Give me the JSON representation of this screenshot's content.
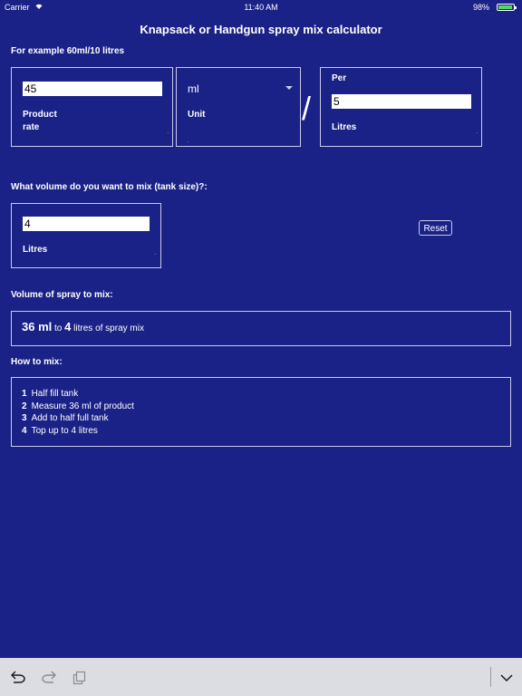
{
  "status_bar": {
    "carrier": "Carrier",
    "time": "11:40 AM",
    "battery": "98%",
    "battery_color": "#4cd964"
  },
  "header": {
    "title": "Knapsack or Handgun spray mix calculator"
  },
  "rate_section": {
    "example": "For example 60ml/10 litres",
    "product_rate": {
      "value": "45",
      "label_line1": "Product",
      "label_line2": "rate"
    },
    "unit": {
      "value": "ml",
      "label": "Unit"
    },
    "separator": "/",
    "per": {
      "heading": "Per",
      "value": "5",
      "label": "Litres"
    }
  },
  "tank_section": {
    "question": "What volume do you want to mix (tank size)?:",
    "tank": {
      "value": "4",
      "label": "Litres"
    },
    "reset_label": "Reset"
  },
  "result_section": {
    "heading": "Volume of spray to mix:",
    "amount": "36 ml",
    "to_text": "to",
    "tank_volume": "4",
    "suffix": "litres of spray mix"
  },
  "howto_section": {
    "heading": "How to mix:",
    "steps": [
      {
        "num": "1",
        "text": "Half fill tank"
      },
      {
        "num": "2",
        "text": "Measure 36 ml of product"
      },
      {
        "num": "3",
        "text": "Add to half full tank"
      },
      {
        "num": "4",
        "text": "Top up to 4 litres"
      }
    ]
  },
  "toolbar": {
    "icons": [
      "undo-icon",
      "redo-icon",
      "clipboard-icon",
      "chevron-down-icon"
    ]
  },
  "colors": {
    "background": "#1a2287",
    "border": "#c8cbe8",
    "toolbar": "#dcdde3"
  }
}
